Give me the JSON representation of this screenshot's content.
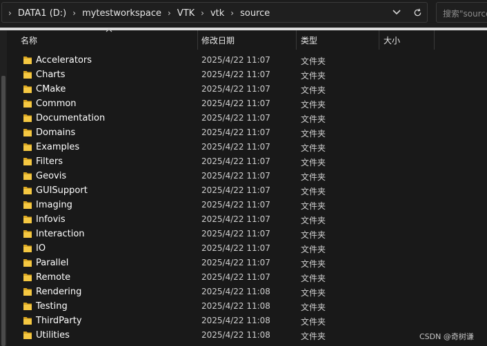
{
  "breadcrumb": [
    {
      "label": "DATA1 (D:)"
    },
    {
      "label": "mytestworkspace"
    },
    {
      "label": "VTK"
    },
    {
      "label": "vtk"
    },
    {
      "label": "source"
    }
  ],
  "address_bar": {
    "dropdown_icon": "chevron-down-icon",
    "refresh_icon": "refresh-icon"
  },
  "search": {
    "placeholder": "搜索\"source"
  },
  "columns": {
    "name": "名称",
    "date": "修改日期",
    "type": "类型",
    "size": "大小",
    "sorted_by": "name",
    "sort_icon": "sort-up-icon"
  },
  "colors": {
    "background": "#191919",
    "folder": "#f5c842",
    "text": "#ffffff",
    "secondary_text": "#cfcfcf"
  },
  "files": [
    {
      "name": "Accelerators",
      "date": "2025/4/22 11:07",
      "type": "文件夹",
      "icon": "folder-icon"
    },
    {
      "name": "Charts",
      "date": "2025/4/22 11:07",
      "type": "文件夹",
      "icon": "folder-icon"
    },
    {
      "name": "CMake",
      "date": "2025/4/22 11:07",
      "type": "文件夹",
      "icon": "folder-icon"
    },
    {
      "name": "Common",
      "date": "2025/4/22 11:07",
      "type": "文件夹",
      "icon": "folder-icon"
    },
    {
      "name": "Documentation",
      "date": "2025/4/22 11:07",
      "type": "文件夹",
      "icon": "folder-icon"
    },
    {
      "name": "Domains",
      "date": "2025/4/22 11:07",
      "type": "文件夹",
      "icon": "folder-icon"
    },
    {
      "name": "Examples",
      "date": "2025/4/22 11:07",
      "type": "文件夹",
      "icon": "folder-icon"
    },
    {
      "name": "Filters",
      "date": "2025/4/22 11:07",
      "type": "文件夹",
      "icon": "folder-icon"
    },
    {
      "name": "Geovis",
      "date": "2025/4/22 11:07",
      "type": "文件夹",
      "icon": "folder-icon"
    },
    {
      "name": "GUISupport",
      "date": "2025/4/22 11:07",
      "type": "文件夹",
      "icon": "folder-icon"
    },
    {
      "name": "Imaging",
      "date": "2025/4/22 11:07",
      "type": "文件夹",
      "icon": "folder-icon"
    },
    {
      "name": "Infovis",
      "date": "2025/4/22 11:07",
      "type": "文件夹",
      "icon": "folder-icon"
    },
    {
      "name": "Interaction",
      "date": "2025/4/22 11:07",
      "type": "文件夹",
      "icon": "folder-icon"
    },
    {
      "name": "IO",
      "date": "2025/4/22 11:07",
      "type": "文件夹",
      "icon": "folder-icon"
    },
    {
      "name": "Parallel",
      "date": "2025/4/22 11:07",
      "type": "文件夹",
      "icon": "folder-icon"
    },
    {
      "name": "Remote",
      "date": "2025/4/22 11:07",
      "type": "文件夹",
      "icon": "folder-icon"
    },
    {
      "name": "Rendering",
      "date": "2025/4/22 11:08",
      "type": "文件夹",
      "icon": "folder-icon"
    },
    {
      "name": "Testing",
      "date": "2025/4/22 11:08",
      "type": "文件夹",
      "icon": "folder-icon"
    },
    {
      "name": "ThirdParty",
      "date": "2025/4/22 11:08",
      "type": "文件夹",
      "icon": "folder-icon"
    },
    {
      "name": "Utilities",
      "date": "2025/4/22 11:08",
      "type": "文件夹",
      "icon": "folder-icon"
    }
  ],
  "watermark": "CSDN @奇树谦"
}
